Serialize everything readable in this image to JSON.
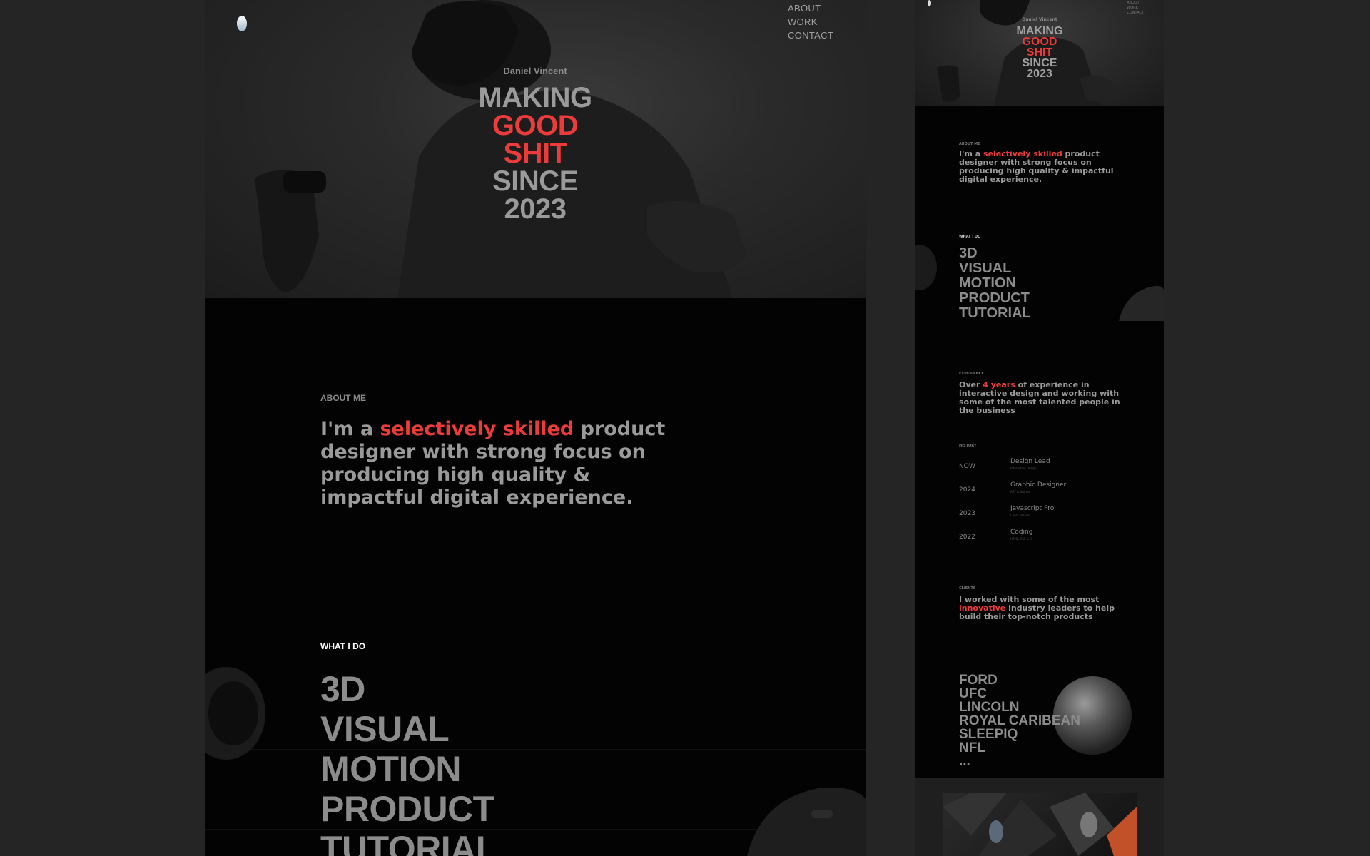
{
  "main": {
    "nav": [
      "ABOUT",
      "WORK",
      "CONTACT"
    ],
    "hero": {
      "name": "Daniel Vincent",
      "line1": "MAKING",
      "line2": "GOOD",
      "line3": "SHIT",
      "line4": "SINCE",
      "line5": "2023"
    },
    "about": {
      "label": "ABOUT ME",
      "pre": "I'm a ",
      "highlight": "selectively skilled",
      "post": " product designer with strong focus on producing high quality & impactful digital experience."
    },
    "services": {
      "label": "WHAT I DO",
      "items": [
        "3D",
        "VISUAL",
        "MOTION",
        "PRODUCT",
        "TUTORIAL"
      ]
    }
  },
  "side": {
    "nav": [
      "ABOUT",
      "WORK",
      "CONTACT"
    ],
    "hero": {
      "name": "Daniel Vincent",
      "line1": "MAKING",
      "line2": "GOOD",
      "line3": "SHIT",
      "line4": "SINCE",
      "line5": "2023"
    },
    "about": {
      "label": "ABOUT ME",
      "pre": "I'm a ",
      "highlight": "selectively skilled",
      "post": " product designer with strong focus on producing high quality & impactful digital experience."
    },
    "services": {
      "label": "WHAT I DO",
      "items": [
        "3D",
        "VISUAL",
        "MOTION",
        "PRODUCT",
        "TUTORIAL"
      ]
    },
    "experience": {
      "label": "EXPERIENCE",
      "pre": "Over ",
      "highlight": "4 years",
      "post": " of experience in interactive design and working with some of the most talented people in the business"
    },
    "history": {
      "label": "HISTORY",
      "rows": [
        {
          "year": "NOW",
          "role": "Design Lead",
          "sub": "Interactive Design"
        },
        {
          "year": "2024",
          "role": "Graphic Designer",
          "sub": "ART & Games"
        },
        {
          "year": "2023",
          "role": "Javascript Pro",
          "sub": "Client session"
        },
        {
          "year": "2022",
          "role": "Coding",
          "sub": "HTML, CSS & JS"
        }
      ]
    },
    "clients": {
      "label": "CLIENTS",
      "pre": "I worked with some of the most ",
      "highlight": "innovative",
      "post": " industry leaders to help build their top-notch products",
      "list": [
        "FORD",
        "UFC",
        "LINCOLN",
        "ROYAL CARIBEAN",
        "SLEEPIQ",
        "NFL",
        "..."
      ]
    }
  },
  "colors": {
    "accent": "#ec3b3b",
    "background": "#252525",
    "panel": "#030303"
  }
}
